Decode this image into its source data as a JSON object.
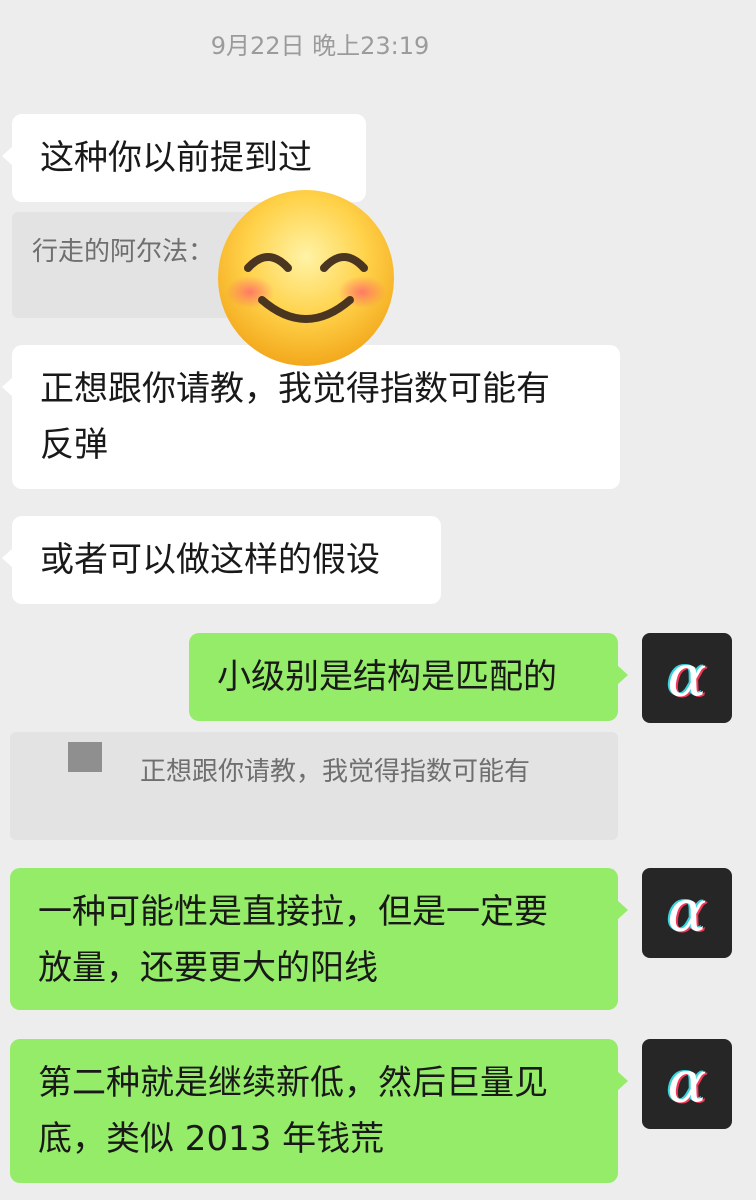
{
  "timestamp": "9月22日 晚上23:19",
  "messages": {
    "m1": "这种你以前提到过",
    "q1": "行走的阿尔法：",
    "m2_line1": "正想跟你请教，我觉得指数可能有",
    "m2_line2": "反弹",
    "m3": "或者可以做这样的假设",
    "m4": "小级别是结构是匹配的",
    "q2": "正想跟你请教，我觉得指数可能有",
    "m5_line1": "一种可能性是直接拉，但是一定要",
    "m5_line2": "放量，还要更大的阳线",
    "m6_line1": "第二种就是继续新低，然后巨量见",
    "m6_line2": "底，类似 2013 年钱荒"
  },
  "avatar": {
    "glyph": "α",
    "icon": "alpha-avatar-icon"
  },
  "colors": {
    "background": "#ededed",
    "incoming_bubble": "#ffffff",
    "outgoing_bubble": "#95ec69",
    "quote_bg": "#e3e3e3",
    "avatar_bg": "#262626"
  }
}
